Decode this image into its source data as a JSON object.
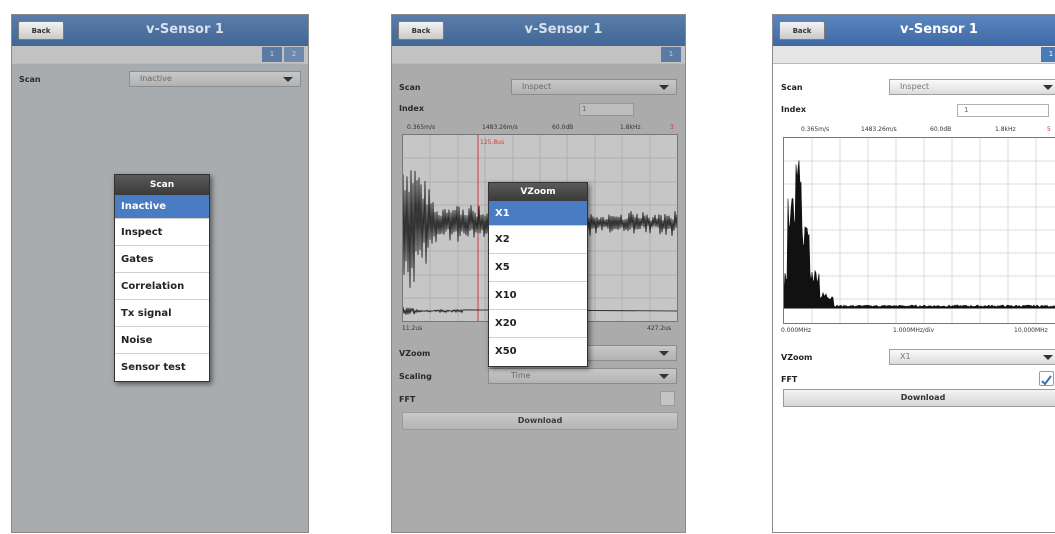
{
  "screens": [
    {
      "back_label": "Back",
      "title": "v-Sensor 1",
      "tabs": [
        "1",
        "2"
      ],
      "scan_label": "Scan",
      "scan_value": "Inactive",
      "popup": {
        "header": "Scan",
        "selected": "Inactive",
        "items": [
          "Inactive",
          "Inspect",
          "Gates",
          "Correlation",
          "Tx signal",
          "Noise",
          "Sensor test"
        ]
      }
    },
    {
      "back_label": "Back",
      "title": "v-Sensor 1",
      "tabs": [
        "1"
      ],
      "scan_label": "Scan",
      "scan_value": "Inspect",
      "index_label": "Index",
      "index_value": "1",
      "readouts": [
        "0.365m/s",
        "1483.26m/s",
        "60.0dB",
        "1.8kHz",
        "3"
      ],
      "cursor_label": "125.8us",
      "x_min": "11.2us",
      "x_max": "427.2us",
      "vzoom_label": "VZoom",
      "scaling_label": "Scaling",
      "scaling_value": "Time",
      "fft_label": "FFT",
      "fft_checked": false,
      "download_label": "Download",
      "popup": {
        "header": "VZoom",
        "selected": "X1",
        "items": [
          "X1",
          "X2",
          "X5",
          "X10",
          "X20",
          "X50"
        ]
      }
    },
    {
      "back_label": "Back",
      "title": "v-Sensor 1",
      "tabs": [
        "1"
      ],
      "scan_label": "Scan",
      "scan_value": "Inspect",
      "index_label": "Index",
      "index_value": "1",
      "readouts": [
        "0.365m/s",
        "1483.26m/s",
        "60.0dB",
        "1.8kHz",
        "5"
      ],
      "x_min": "0.000MHz",
      "x_mid": "1.000MHz/div",
      "x_max": "10.000MHz",
      "vzoom_label": "VZoom",
      "vzoom_value": "X1",
      "fft_label": "FFT",
      "fft_checked": true,
      "download_label": "Download"
    }
  ],
  "colors": {
    "title_blue": "#4a76b2",
    "selected_blue": "#4a7cc3",
    "cursor_red": "#d23a3a"
  }
}
